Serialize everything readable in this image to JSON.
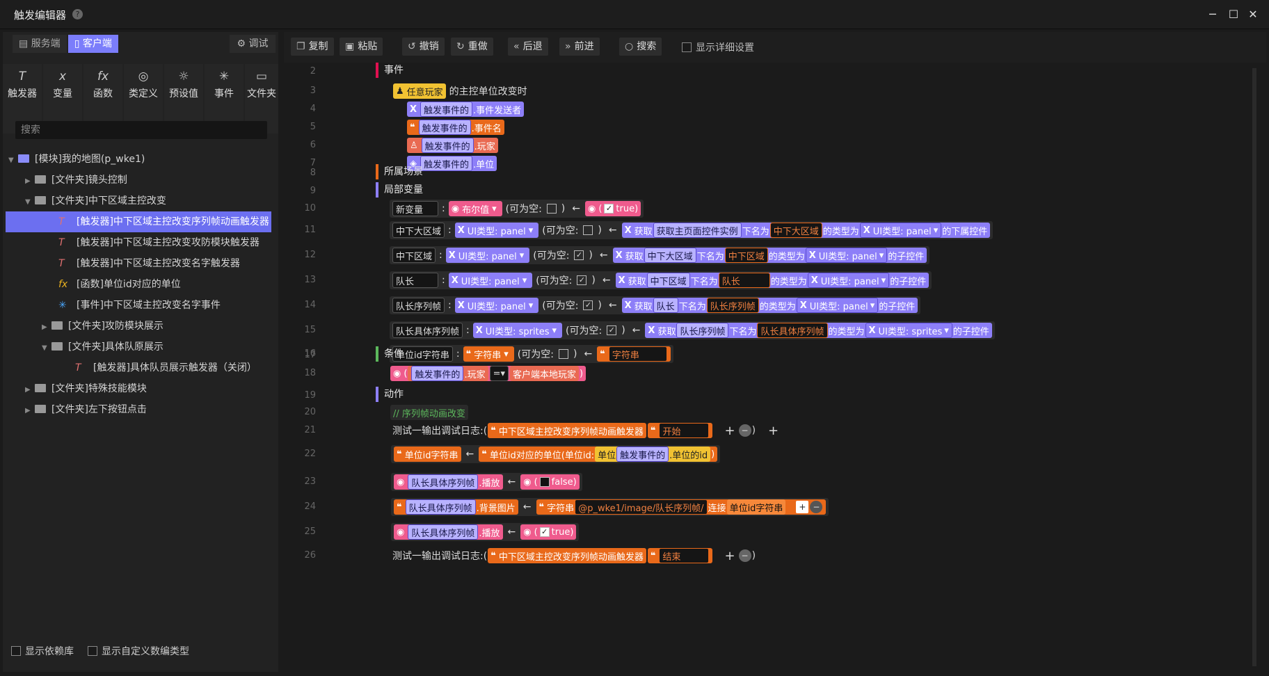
{
  "window": {
    "title": "触发编辑器",
    "help": "?",
    "min": "─",
    "max": "☐",
    "close": "✕"
  },
  "side_tabs": {
    "server": "服务端",
    "client": "客户端",
    "debug": "调试"
  },
  "icon_tools": [
    {
      "icon": "T",
      "label": "触发器"
    },
    {
      "icon": "x",
      "label": "变量"
    },
    {
      "icon": "fx",
      "label": "函数"
    },
    {
      "icon": "◎",
      "label": "类定义"
    },
    {
      "icon": "☼",
      "label": "预设值"
    },
    {
      "icon": "✳",
      "label": "事件"
    },
    {
      "icon": "▭",
      "label": "文件夹"
    }
  ],
  "search_placeholder": "搜索",
  "tree": [
    "[模块]我的地图(p_wke1)",
    "[文件夹]镜头控制",
    "[文件夹]中下区域主控改变",
    "[触发器]中下区域主控改变序列帧动画触发器",
    "[触发器]中下区域主控改变攻防模块触发器",
    "[触发器]中下区域主控改变名字触发器",
    "[函数]单位id对应的单位",
    "[事件]中下区域主控改变名字事件",
    "[文件夹]攻防模块展示",
    "[文件夹]具体队原展示",
    "[触发器]具体队员展示触发器（关闭）",
    "[文件夹]特殊技能模块",
    "[文件夹]左下按钮点击"
  ],
  "bottom": {
    "dep": "显示依赖库",
    "custom": "显示自定义数编类型"
  },
  "toolbar": {
    "copy": "复制",
    "paste": "粘贴",
    "undo": "撤销",
    "redo": "重做",
    "back": "后退",
    "forward": "前进",
    "search": "搜索",
    "detail": "显示详细设置"
  },
  "line_numbers": [
    "2",
    "3",
    "4",
    "5",
    "6",
    "7",
    "8",
    "9",
    "10",
    "11",
    "12",
    "13",
    "14",
    "15",
    "16",
    "17",
    "18",
    "19",
    "20",
    "21",
    "22",
    "23",
    "24",
    "25",
    "26"
  ],
  "code": {
    "event": "事件",
    "any_player": "任意玩家",
    "main_change": "的主控单位改变时",
    "trig_ev": "触发事件的",
    "sender": ".事件发送者",
    "evname": ".事件名",
    "player": ".玩家",
    "unit": ".单位",
    "scene": "所属场景",
    "local": "局部变量",
    "newvar": "新变量",
    "colon": ":",
    "bool": "布尔值",
    "nullable": "(可为空:",
    "close_p": ")",
    "arrow": "←",
    "true_v": "true)",
    "false_v": "false)",
    "open_p": "(",
    "v_zhongda": "中下大区域",
    "ui_panel": "UI类型: panel",
    "get": "获取",
    "get_main": "获取主页面控件实例",
    "name_is": "下名为",
    "type_is": "的类型为",
    "sub_ctrl": "的下属控件",
    "child_ctrl": "的子控件",
    "v_zhong": "中下区域",
    "v_dz": "队长",
    "v_dzxl": "队长序列帧",
    "v_dzjt": "队长具体序列帧",
    "ui_sprites": "UI类型: sprites",
    "v_uid": "单位id字符串",
    "string": "字符串",
    "cond": "条件",
    "eq": "=",
    "local_player": "客户端本地玩家",
    "action": "动作",
    "comment": "// 序列帧动画改变",
    "log": "测试一输出调试日志:(",
    "trig_name": "中下区域主控改变序列帧动画触发器",
    "start": "开始",
    "end": "结束",
    "plus": "+",
    "minus": "−",
    "func_call": "单位id对应的单位(单位id:",
    "unit_w": "单位",
    "id": "的id",
    "play": ".播放",
    "bg": ".背景图片",
    "path": "@p_wke1/image/队长序列帧/",
    "concat": "连接"
  }
}
